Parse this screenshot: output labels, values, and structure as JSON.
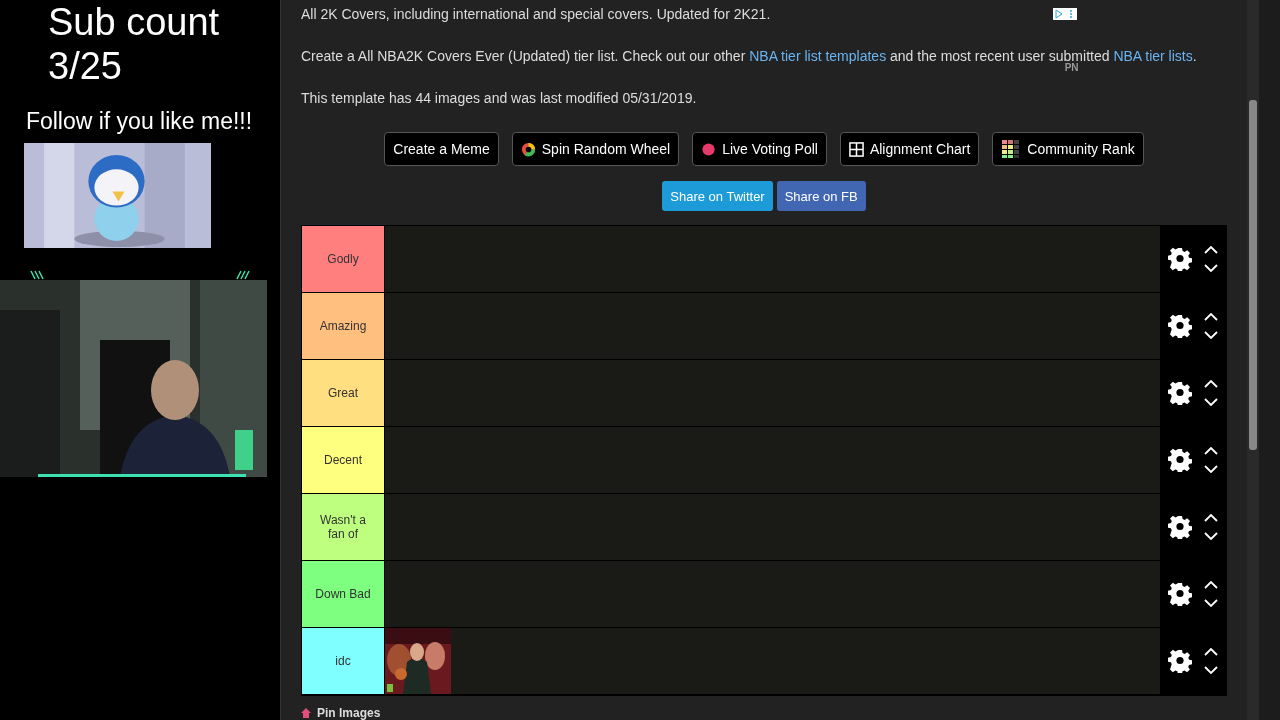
{
  "overlay": {
    "sub_label": "Sub count",
    "sub_value": "3/25",
    "follow": "Follow if you like me!!!"
  },
  "page": {
    "intro": "All 2K Covers, including international and special covers. Updated for 2K21.",
    "description": [
      {
        "kind": "text",
        "text": "Create a All NBA2K Covers Ever (Updated) tier list. Check out our other "
      },
      {
        "kind": "link",
        "text": "NBA tier list templates"
      },
      {
        "kind": "text",
        "text": " and the most recent user submitted "
      },
      {
        "kind": "link",
        "text": "NBA tier lists"
      },
      {
        "kind": "text",
        "text": "."
      }
    ],
    "badge": "PN",
    "meta": "This template has 44 images and was last modified 05/31/2019.",
    "tools": [
      {
        "label": "Create a Meme",
        "kind": "none"
      },
      {
        "label": "Spin Random Wheel",
        "kind": "wheel"
      },
      {
        "label": "Live Voting Poll",
        "kind": "dot"
      },
      {
        "label": "Alignment Chart",
        "kind": "grid"
      },
      {
        "label": "Community Rank",
        "kind": "rank"
      }
    ],
    "share": [
      {
        "label": "Share on Twitter",
        "color": "#1d9bd8"
      },
      {
        "label": "Share on FB",
        "color": "#4267b2"
      }
    ],
    "tiers": [
      {
        "label": "Godly",
        "color": "#ff7f7f"
      },
      {
        "label": "Amazing",
        "color": "#ffbf7f"
      },
      {
        "label": "Great",
        "color": "#ffdf7f"
      },
      {
        "label": "Decent",
        "color": "#ffff7f"
      },
      {
        "label": "Wasn't a fan of",
        "color": "#bfff7f"
      },
      {
        "label": "Down Bad",
        "color": "#7fff7f"
      },
      {
        "label": "idc",
        "color": "#7fffff"
      }
    ],
    "pin": "Pin Images"
  }
}
